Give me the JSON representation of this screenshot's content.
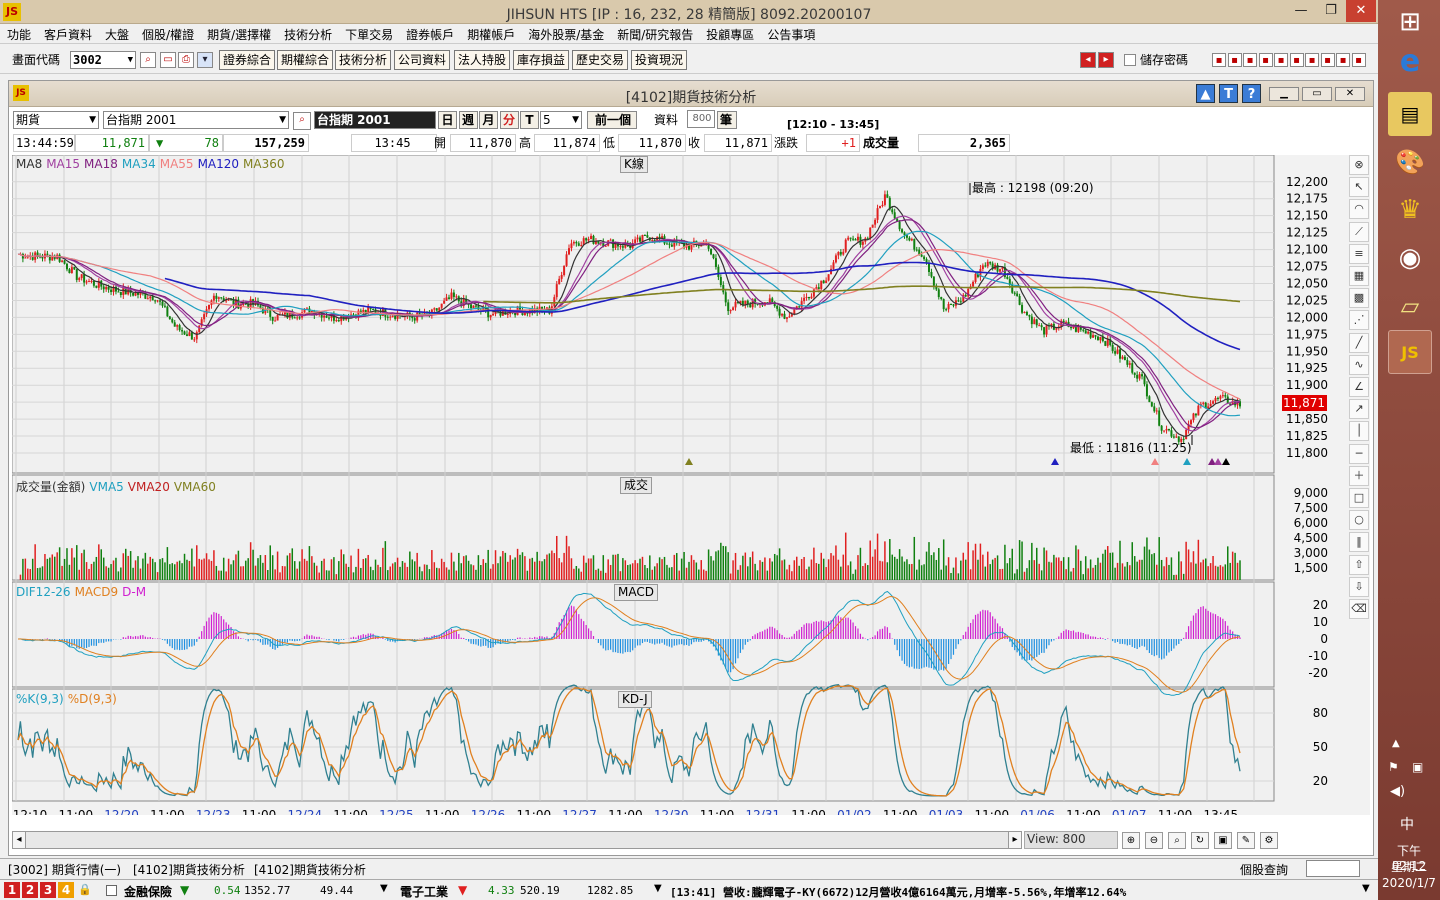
{
  "app": {
    "title": "JIHSUN HTS      [IP : 16, 232, 28 精簡版] 8092.20200107",
    "logo": "JS"
  },
  "menu": [
    "功能",
    "客戶資料",
    "大盤",
    "個股/權證",
    "期貨/選擇權",
    "技術分析",
    "下單交易",
    "證券帳戶",
    "期權帳戶",
    "海外股票/基金",
    "新聞/研究報告",
    "投顧專區",
    "公告事項"
  ],
  "toolbar": {
    "code_label": "畫面代碼",
    "code_value": "3002",
    "buttons": [
      "證券綜合",
      "期權綜合",
      "技術分析",
      "公司資料",
      "法人持股",
      "庫存損益",
      "歷史交易",
      "投資現況"
    ],
    "save_password": "儲存密碼"
  },
  "window": {
    "title": "[4102]期貨技術分析"
  },
  "controls": {
    "market": "期貨",
    "symbol": "台指期 2001",
    "symbol_dark": "台指期 2001",
    "periods": [
      "日",
      "週",
      "月",
      "分",
      "T"
    ],
    "interval": "5",
    "prev": "前一個",
    "data_label": "資料",
    "data_count": "800",
    "unit": "筆",
    "time_range": "[12:10 - 13:45]"
  },
  "quote": {
    "time": "13:44:59",
    "price": "11,871",
    "change": "78",
    "total": "157,259",
    "bar_time": "13:45",
    "open_label": "開",
    "open": "11,870",
    "high_label": "高",
    "high": "11,874",
    "low_label": "低",
    "low": "11,870",
    "close_label": "收",
    "close": "11,871",
    "chg_label": "漲跌",
    "chg": "+1",
    "vol_label": "成交量",
    "vol": "2,365"
  },
  "kline": {
    "title": "K線",
    "legend": [
      {
        "t": "MA8",
        "c": "#333333"
      },
      {
        "t": "MA15",
        "c": "#a040a0"
      },
      {
        "t": "MA18",
        "c": "#802080"
      },
      {
        "t": "MA34",
        "c": "#20a0c0"
      },
      {
        "t": "MA55",
        "c": "#f08080"
      },
      {
        "t": "MA120",
        "c": "#2020c0"
      },
      {
        "t": "MA360",
        "c": "#808020"
      }
    ],
    "y_ticks": [
      "12,200",
      "12,175",
      "12,150",
      "12,125",
      "12,100",
      "12,075",
      "12,050",
      "12,025",
      "12,000",
      "11,975",
      "11,950",
      "11,925",
      "11,900",
      "11,875",
      "11,850",
      "11,825",
      "11,800"
    ],
    "high_note": "最高 : 12198 (09:20)",
    "low_note": "最低 : 11816 (11:25)",
    "last_price": "11,871"
  },
  "volume": {
    "title": "成交",
    "legend": [
      {
        "t": "成交量(金額)",
        "c": "#333333"
      },
      {
        "t": "VMA5",
        "c": "#20a0c0"
      },
      {
        "t": "VMA20",
        "c": "#c02020"
      },
      {
        "t": "VMA60",
        "c": "#808020"
      }
    ],
    "y_ticks": [
      "9,000",
      "7,500",
      "6,000",
      "4,500",
      "3,000",
      "1,500"
    ]
  },
  "macd": {
    "title": "MACD",
    "legend": [
      {
        "t": "DIF12-26",
        "c": "#20a0c0"
      },
      {
        "t": "MACD9",
        "c": "#e08020"
      },
      {
        "t": "D-M",
        "c": "#d020d0"
      }
    ],
    "y_ticks": [
      "20",
      "10",
      "0",
      "-10",
      "-20"
    ]
  },
  "kd": {
    "title": "KD-J",
    "legend": [
      {
        "t": "%K(9,3)",
        "c": "#20a0c0"
      },
      {
        "t": "%D(9,3)",
        "c": "#e08020"
      }
    ],
    "y_ticks": [
      "80",
      "50",
      "20"
    ]
  },
  "x_ticks": [
    {
      "t": "12:10",
      "d": false
    },
    {
      "t": "11:00",
      "d": false
    },
    {
      "t": "12/20",
      "d": true
    },
    {
      "t": "11:00",
      "d": false
    },
    {
      "t": "12/23",
      "d": true
    },
    {
      "t": "11:00",
      "d": false
    },
    {
      "t": "12/24",
      "d": true
    },
    {
      "t": "11:00",
      "d": false
    },
    {
      "t": "12/25",
      "d": true
    },
    {
      "t": "11:00",
      "d": false
    },
    {
      "t": "12/26",
      "d": true
    },
    {
      "t": "11:00",
      "d": false
    },
    {
      "t": "12/27",
      "d": true
    },
    {
      "t": "11:00",
      "d": false
    },
    {
      "t": "12/30",
      "d": true
    },
    {
      "t": "11:00",
      "d": false
    },
    {
      "t": "12/31",
      "d": true
    },
    {
      "t": "11:00",
      "d": false
    },
    {
      "t": "01/02",
      "d": true
    },
    {
      "t": "11:00",
      "d": false
    },
    {
      "t": "01/03",
      "d": true
    },
    {
      "t": "11:00",
      "d": false
    },
    {
      "t": "01/06",
      "d": true
    },
    {
      "t": "11:00",
      "d": false
    },
    {
      "t": "01/07",
      "d": true
    },
    {
      "t": "11:00",
      "d": false
    },
    {
      "t": "13:45",
      "d": false
    }
  ],
  "view": "View: 800",
  "tabs": [
    "[3002] 期貨行情(一)",
    "[4102]期貨技術分析",
    "[4102]期貨技術分析"
  ],
  "tab_right": "個股查詢",
  "status": {
    "nums": [
      "1",
      "2",
      "3",
      "4"
    ],
    "s1_name": "金融保險",
    "s1_chg": "0.54",
    "s1_idx": "1352.77",
    "s1_vol": "49.44",
    "s2_name": "電子工業",
    "s2_chg": "4.33",
    "s2_idx": "520.19",
    "s2_vol": "1282.85",
    "news": "[13:41] 營收:朧輝電子-KY(6672)12月營收4億6164萬元,月增率-5.56%,年增率12.64%"
  },
  "clock": {
    "ampm": "下午 02:12",
    "weekday": "星期二",
    "date": "2020/1/7",
    "ime": "中"
  },
  "colors": {
    "up": "#e02020",
    "down": "#108010",
    "accent": "#3b7cd6"
  },
  "chart_data": {
    "type": "candlestick",
    "title": "K線",
    "ylim": [
      11800,
      12210
    ],
    "series": [
      {
        "name": "Close (approx)",
        "values": [
          12093,
          12090,
          12090,
          12060,
          12048,
          12040,
          12035,
          12030,
          11985,
          11970,
          12035,
          12020,
          12020,
          12000,
          12005,
          12010,
          12000,
          12005,
          12010,
          12005,
          12000,
          12005,
          12030,
          12015,
          12005,
          12010,
          12010,
          12010,
          12110,
          12115,
          12110,
          12105,
          12120,
          12110,
          12105,
          12110,
          12015,
          12020,
          12025,
          12000,
          12030,
          12060,
          12110,
          12115,
          12180,
          12120,
          12090,
          12010,
          12030,
          12080,
          12070,
          12010,
          11980,
          11990,
          11980,
          11970,
          11940,
          11910,
          11840,
          11820,
          11870,
          11880,
          11871
        ]
      }
    ]
  }
}
